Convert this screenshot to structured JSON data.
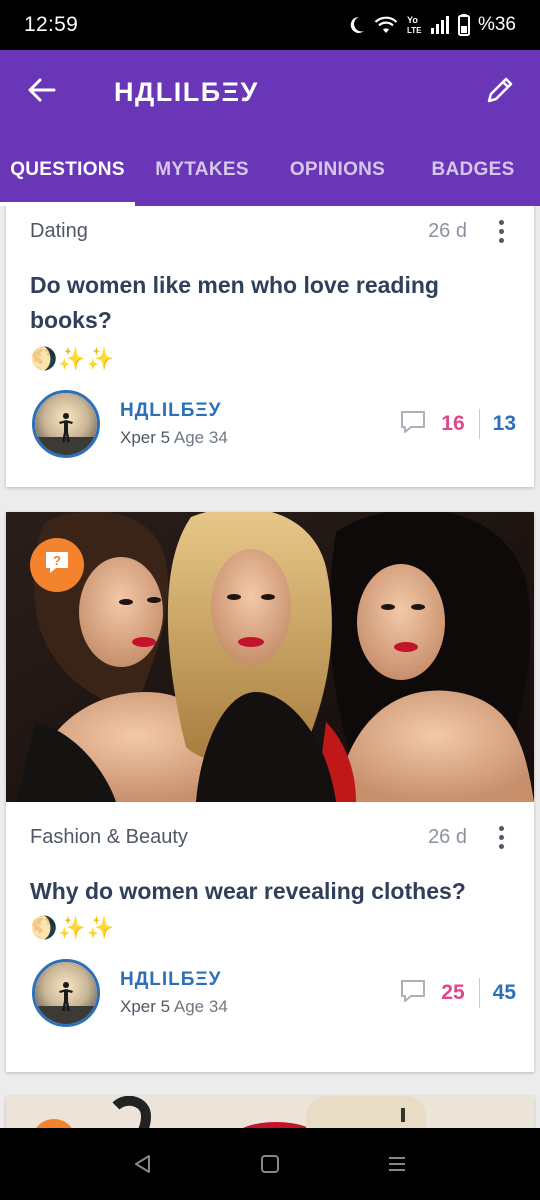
{
  "status_bar": {
    "time": "12:59",
    "battery": "%36",
    "icons": [
      "moon-icon",
      "wifi-icon",
      "volte-icon",
      "signal-icon",
      "battery-icon"
    ]
  },
  "app_bar": {
    "title": "НДLILБΞУ",
    "icons": [
      "back-arrow-icon",
      "pencil-icon"
    ]
  },
  "tabs": [
    {
      "label": "QUESTIONS",
      "active": true
    },
    {
      "label": "MYTAKES",
      "active": false
    },
    {
      "label": "OPINIONS",
      "active": false
    },
    {
      "label": "BADGES",
      "active": false
    }
  ],
  "posts": [
    {
      "category": "Dating",
      "age": "26 d",
      "title": "Do women like men who love reading books?",
      "emojis": "🌖✨✨",
      "author": {
        "name": "НДLILБΞУ",
        "level": "Xper 5",
        "age": "Age 34"
      },
      "comments": "16",
      "opinions": "13"
    },
    {
      "category": "Fashion & Beauty",
      "age": "26 d",
      "title": "Why do women wear revealing clothes?",
      "emojis": "🌖✨✨",
      "has_image": true,
      "author": {
        "name": "НДLILБΞУ",
        "level": "Xper 5",
        "age": "Age 34"
      },
      "comments": "25",
      "opinions": "45"
    }
  ],
  "colors": {
    "app_bar": "#6a36b8",
    "comment_count": "#e0468c",
    "opinion_count": "#2d6fb8",
    "question_badge": "#f4832d"
  }
}
